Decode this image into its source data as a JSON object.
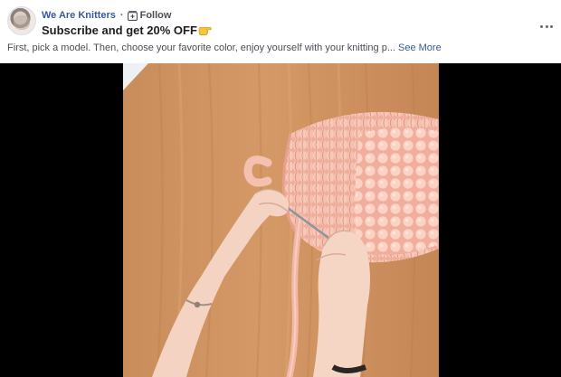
{
  "post": {
    "page_name": "We Are Knitters",
    "separator": "·",
    "follow_label": "Follow",
    "headline": "Subscribe and get 20% OFF",
    "caption": "First, pick a model. Then, choose your favorite color, enjoy yourself with your knitting p...",
    "see_more_label": "See More",
    "more_icon": "more-horizontal-icon",
    "headline_emoji": "backhand-index-pointing-right"
  },
  "colors": {
    "link_blue": "#3b5998",
    "text_primary": "#1c1e21",
    "text_secondary": "#4b4f56",
    "video_background": "#000000",
    "wood": "#c98d5b",
    "yarn": "#f2b7a6"
  }
}
